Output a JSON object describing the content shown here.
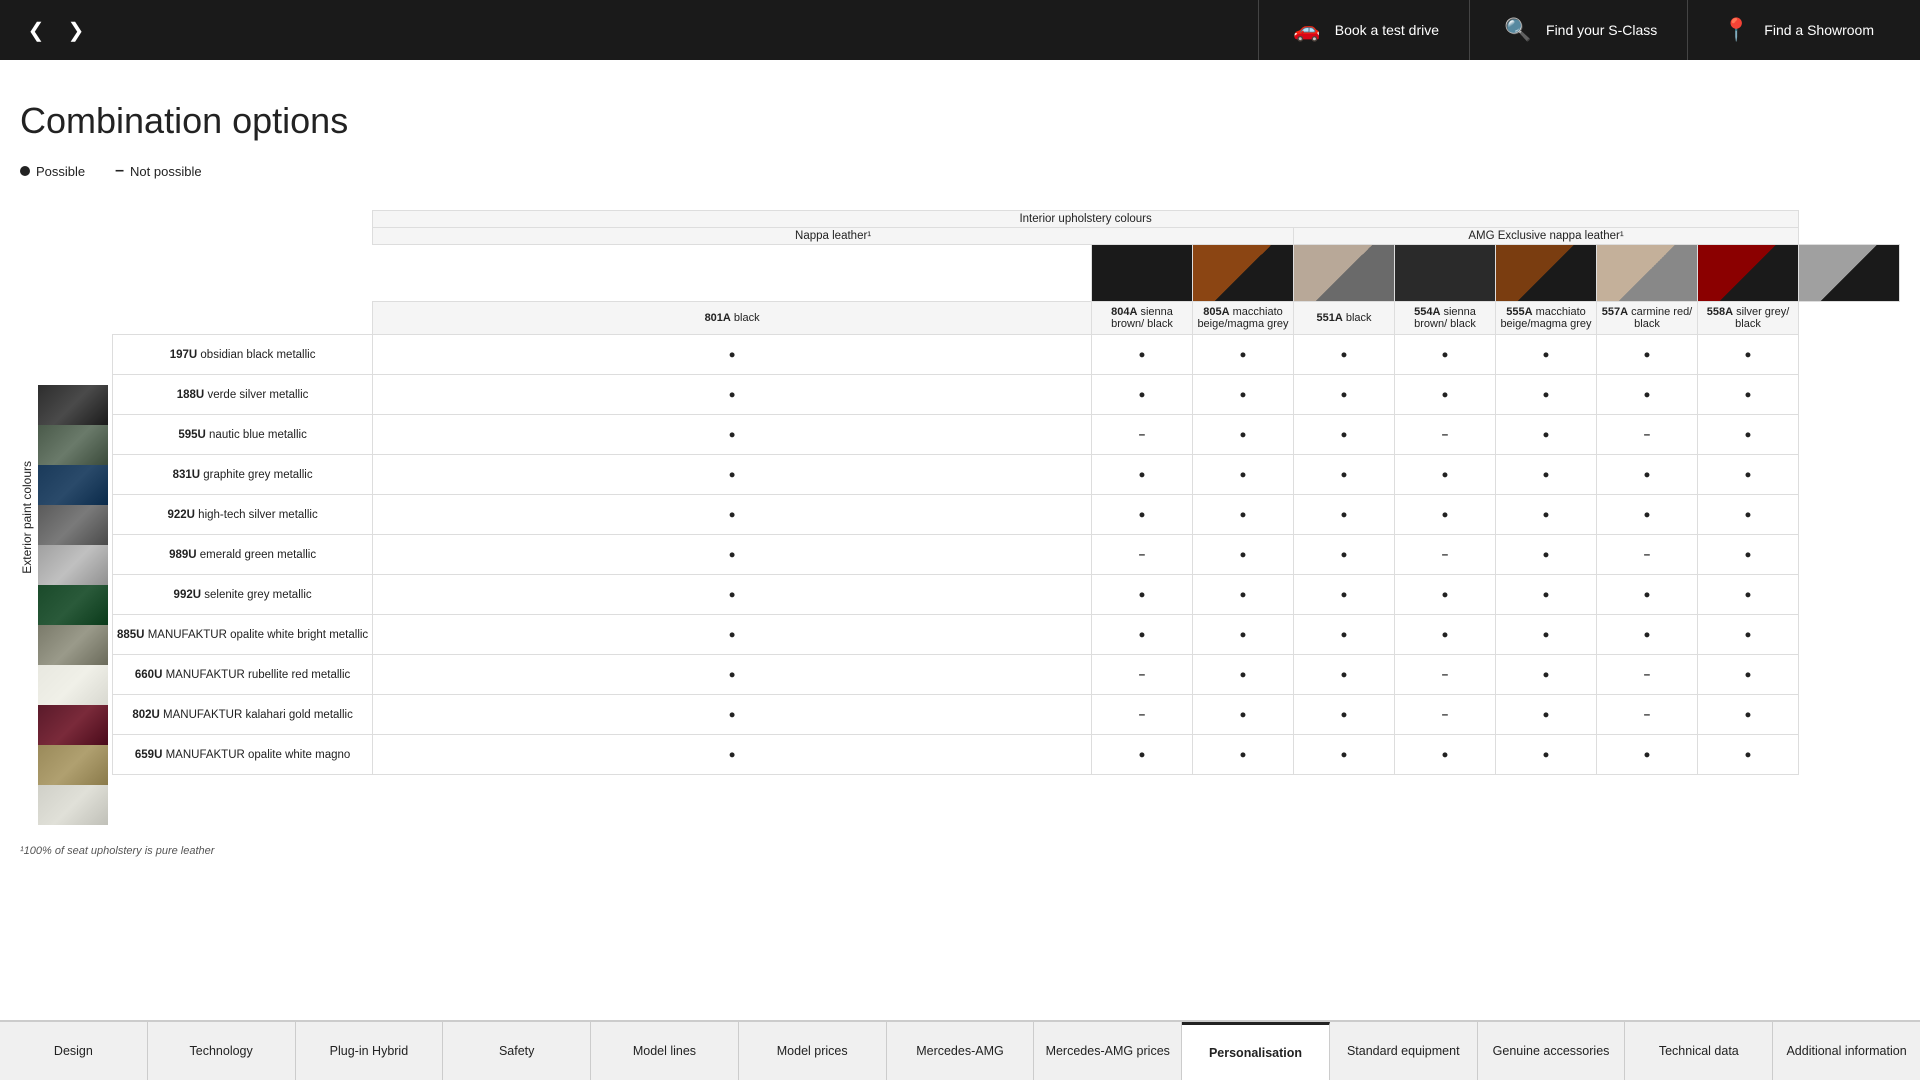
{
  "topNav": {
    "prevArrow": "❮",
    "nextArrow": "❯",
    "actions": [
      {
        "id": "test-drive",
        "icon": "🚗",
        "label": "Book a test drive"
      },
      {
        "id": "find-s-class",
        "icon": "🔍",
        "label": "Find your S-Class"
      },
      {
        "id": "find-showroom",
        "icon": "📍",
        "label": "Find a Showroom"
      }
    ]
  },
  "pageTitle": "Combination options",
  "legend": {
    "possible": "Possible",
    "notPossible": "Not possible"
  },
  "tableHeaders": {
    "interiorTitle": "Interior upholstery colours",
    "nappaTitle": "Nappa leather¹",
    "amgNappaTitle": "AMG Exclusive nappa leather¹"
  },
  "upholsteryColumns": [
    {
      "id": "801A",
      "code": "801A",
      "name": "black",
      "colorClass": "cb-black"
    },
    {
      "id": "804A",
      "code": "804A",
      "name": "sienna brown/ black",
      "colorClass": "cb-sienna"
    },
    {
      "id": "805A",
      "code": "805A",
      "name": "macchiato beige/magma grey",
      "colorClass": "cb-macchiato"
    },
    {
      "id": "551A",
      "code": "551A",
      "name": "black",
      "colorClass": "cb-amg-black"
    },
    {
      "id": "554A",
      "code": "554A",
      "name": "sienna brown/ black",
      "colorClass": "cb-amg-sienna"
    },
    {
      "id": "555A",
      "code": "555A",
      "name": "macchiato beige/magma grey",
      "colorClass": "cb-amg-macchiato"
    },
    {
      "id": "557A",
      "code": "557A",
      "name": "carmine red/ black",
      "colorClass": "cb-carmine"
    },
    {
      "id": "558A",
      "code": "558A",
      "name": "silver grey/ black",
      "colorClass": "cb-silver"
    }
  ],
  "exteriorColors": [
    {
      "code": "197U",
      "name": "obsidian black metallic",
      "swatchClass": "sw-obsidian",
      "values": [
        "●",
        "●",
        "●",
        "●",
        "●",
        "●",
        "●",
        "●"
      ]
    },
    {
      "code": "188U",
      "name": "verde silver metallic",
      "swatchClass": "sw-verde",
      "values": [
        "●",
        "●",
        "●",
        "●",
        "●",
        "●",
        "●",
        "●"
      ]
    },
    {
      "code": "595U",
      "name": "nautic blue metallic",
      "swatchClass": "sw-nautic",
      "values": [
        "●",
        "–",
        "●",
        "●",
        "–",
        "●",
        "–",
        "●"
      ]
    },
    {
      "code": "831U",
      "name": "graphite grey metallic",
      "swatchClass": "sw-graphite",
      "values": [
        "●",
        "●",
        "●",
        "●",
        "●",
        "●",
        "●",
        "●"
      ]
    },
    {
      "code": "922U",
      "name": "high-tech silver metallic",
      "swatchClass": "sw-hightech",
      "values": [
        "●",
        "●",
        "●",
        "●",
        "●",
        "●",
        "●",
        "●"
      ]
    },
    {
      "code": "989U",
      "name": "emerald green metallic",
      "swatchClass": "sw-emerald",
      "values": [
        "●",
        "–",
        "●",
        "●",
        "–",
        "●",
        "–",
        "●"
      ]
    },
    {
      "code": "992U",
      "name": "selenite grey metallic",
      "swatchClass": "sw-selenite",
      "values": [
        "●",
        "●",
        "●",
        "●",
        "●",
        "●",
        "●",
        "●"
      ]
    },
    {
      "code": "885U",
      "name": "MANUFAKTUR opalite white bright metallic",
      "swatchClass": "sw-opalite",
      "values": [
        "●",
        "●",
        "●",
        "●",
        "●",
        "●",
        "●",
        "●"
      ]
    },
    {
      "code": "660U",
      "name": "MANUFAKTUR rubellite red metallic",
      "swatchClass": "sw-rubellite",
      "values": [
        "●",
        "–",
        "●",
        "●",
        "–",
        "●",
        "–",
        "●"
      ]
    },
    {
      "code": "802U",
      "name": "MANUFAKTUR kalahari gold metallic",
      "swatchClass": "sw-kalahari",
      "values": [
        "●",
        "–",
        "●",
        "●",
        "–",
        "●",
        "–",
        "●"
      ]
    },
    {
      "code": "659U",
      "name": "MANUFAKTUR opalite white magno",
      "swatchClass": "sw-opalite-magno",
      "values": [
        "●",
        "●",
        "●",
        "●",
        "●",
        "●",
        "●",
        "●"
      ]
    }
  ],
  "exteriorLabel": "Exterior paint colours",
  "footnote": "¹100% of seat upholstery is pure leather",
  "bottomNav": [
    {
      "id": "design",
      "label": "Design",
      "active": false
    },
    {
      "id": "technology",
      "label": "Technology",
      "active": false
    },
    {
      "id": "plugin-hybrid",
      "label": "Plug-in Hybrid",
      "active": false
    },
    {
      "id": "safety",
      "label": "Safety",
      "active": false
    },
    {
      "id": "model-lines",
      "label": "Model lines",
      "active": false
    },
    {
      "id": "model-prices",
      "label": "Model prices",
      "active": false
    },
    {
      "id": "mercedes-amg",
      "label": "Mercedes-AMG",
      "active": false
    },
    {
      "id": "mercedes-amg-prices",
      "label": "Mercedes-AMG prices",
      "active": false
    },
    {
      "id": "personalisation",
      "label": "Personalisation",
      "active": true
    },
    {
      "id": "standard-equipment",
      "label": "Standard equipment",
      "active": false
    },
    {
      "id": "genuine-accessories",
      "label": "Genuine accessories",
      "active": false
    },
    {
      "id": "technical-data",
      "label": "Technical data",
      "active": false
    },
    {
      "id": "additional-information",
      "label": "Additional information",
      "active": false
    }
  ]
}
